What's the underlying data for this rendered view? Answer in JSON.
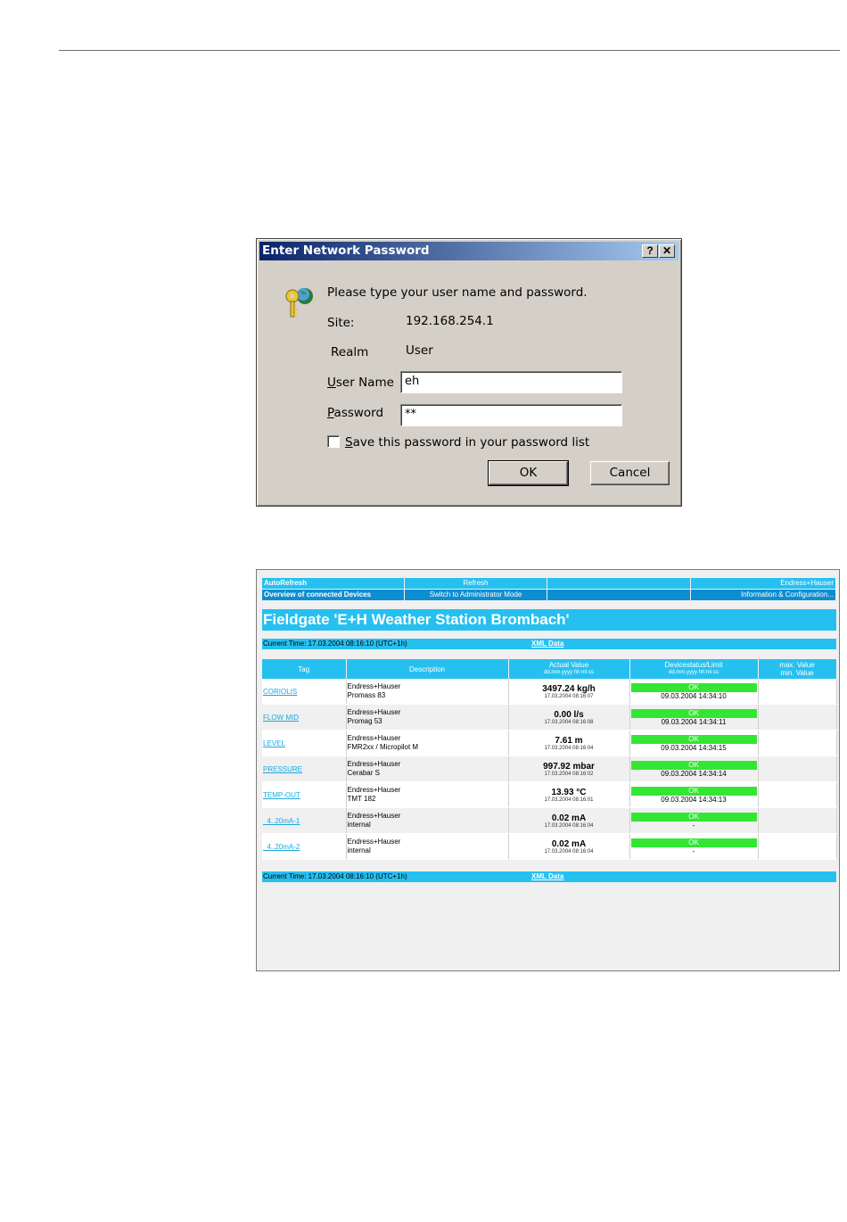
{
  "dialog": {
    "title": "Enter Network Password",
    "help_btn": "?",
    "close_btn": "✕",
    "prompt": "Please type your user name and password.",
    "site_label": "Site:",
    "site_value": "192.168.254.1",
    "realm_label": "Realm",
    "realm_value": "User",
    "username_label_u": "U",
    "username_label_rest": "ser Name",
    "username_value": "eh",
    "password_label_u": "P",
    "password_label_rest": "assword",
    "password_value": "**",
    "save_label_u": "S",
    "save_label_rest": "ave this password in your password list",
    "ok": "OK",
    "cancel": "Cancel"
  },
  "fieldgate": {
    "menu_row1": [
      "AutoRefresh",
      "Refresh",
      "",
      "Endress+Hauser"
    ],
    "menu_row2": [
      "Overview of connected Devices",
      "Switch to Administrator Mode",
      "",
      "Information & Configuration..."
    ],
    "title": "Fieldgate 'E+H Weather Station Brombach'",
    "current_time": "Current Time: 17.03.2004 08:16:10 (UTC+1h)",
    "xml_data": "XML Data",
    "headers": {
      "tag": "Tag",
      "description": "Description",
      "actual": "Actual Value",
      "actual_sub": "dd.mm.yyyy hh:mi:ss",
      "status": "Devicestatus/Limit",
      "status_sub": "dd.mm.yyyy hh:mi:ss",
      "max": "max. Value",
      "min": "min. Value"
    },
    "rows": [
      {
        "tag": "CORIOLIS",
        "desc1": "Endress+Hauser",
        "desc2": "Promass 83",
        "value": "3497.24 kg/h",
        "vtime": "17.03.2004 08:16:07",
        "status": "OK",
        "stime": "09.03.2004 14:34:10"
      },
      {
        "tag": "FLOW MID",
        "desc1": "Endress+Hauser",
        "desc2": "Promag 53",
        "value": "0.00 l/s",
        "vtime": "17.03.2004 08:16:08",
        "status": "OK",
        "stime": "09.03.2004 14:34:11"
      },
      {
        "tag": "LEVEL",
        "desc1": "Endress+Hauser",
        "desc2": "FMR2xx / Micropilot M",
        "value": "7.61 m",
        "vtime": "17.03.2004 08:16:04",
        "status": "OK",
        "stime": "09.03.2004 14:34:15"
      },
      {
        "tag": "PRESSURE",
        "desc1": "Endress+Hauser",
        "desc2": "Cerabar S",
        "value": "997.92 mbar",
        "vtime": "17.03.2004 08:16:02",
        "status": "OK",
        "stime": "09.03.2004 14:34:14"
      },
      {
        "tag": "TEMP-OUT",
        "desc1": "Endress+Hauser",
        "desc2": "TMT 182",
        "value": "13.93 °C",
        "vtime": "17.03.2004 08:16:01",
        "status": "OK",
        "stime": "09.03.2004 14:34:13"
      },
      {
        "tag": "_4..20mA-1",
        "desc1": "Endress+Hauser",
        "desc2": "internal",
        "value": "0.02 mA",
        "vtime": "17.03.2004 08:16:04",
        "status": "OK",
        "stime": "-"
      },
      {
        "tag": "_4..20mA-2",
        "desc1": "Endress+Hauser",
        "desc2": "internal",
        "value": "0.02 mA",
        "vtime": "17.03.2004 08:16:04",
        "status": "OK",
        "stime": "-"
      }
    ]
  },
  "colors": {
    "brand_cyan": "#26c0f0",
    "title_blue": "#0a246a",
    "ok_green": "#33e633"
  }
}
